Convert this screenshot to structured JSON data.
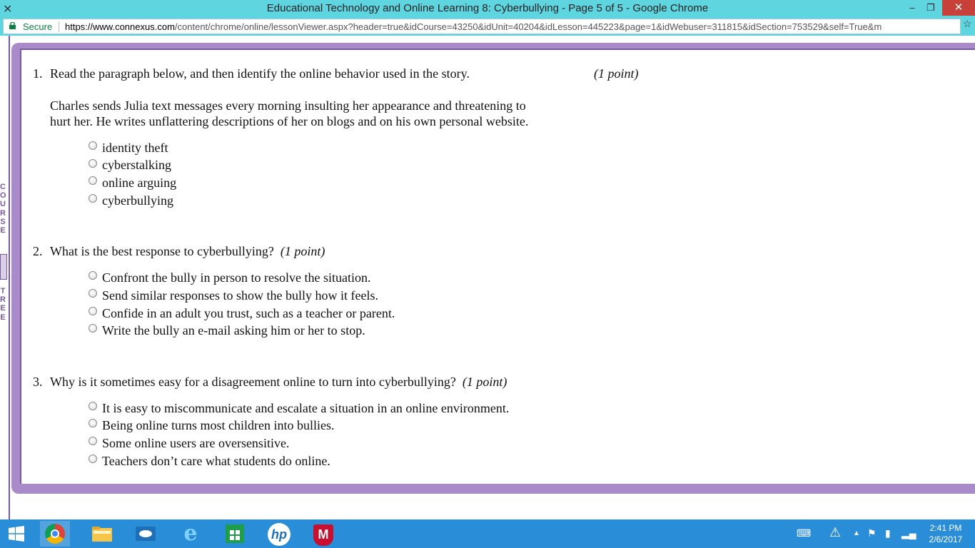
{
  "window": {
    "title": "Educational Technology and Online Learning 8: Cyberbullying - Page 5 of 5 - Google Chrome",
    "minimize": "–",
    "maximize": "❐",
    "close": "✕"
  },
  "address": {
    "secure_label": "Secure",
    "url_domain": "https://www.connexus.com",
    "url_rest": "/content/chrome/online/lessonViewer.aspx?header=true&idCourse=43250&idUnit=40204&idLesson=445223&page=1&idWebuser=311815&idSection=753529&self=True&m"
  },
  "course_tree": {
    "letters": "C O U R S E",
    "letters2": "T R E E"
  },
  "questions": [
    {
      "number": "1.",
      "prompt": "Read the paragraph below, and then identify the online behavior used in the story.",
      "points": "(1 point)",
      "passage_line1": "Charles sends Julia text messages every morning insulting her appearance and threatening to",
      "passage_line2": "hurt her. He writes unflattering descriptions of her on blogs and on his own personal website.",
      "options": [
        "identity theft",
        "cyberstalking",
        "online arguing",
        "cyberbullying"
      ]
    },
    {
      "number": "2.",
      "prompt": "What is the best response to cyberbullying?",
      "points": "(1 point)",
      "options": [
        "Confront the bully in person to resolve the situation.",
        "Send similar responses to show the bully how it feels.",
        "Confide in an adult you trust, such as a teacher or parent.",
        "Write the bully an e-mail asking him or her to stop."
      ]
    },
    {
      "number": "3.",
      "prompt": "Why is it sometimes easy for a disagreement online to turn into cyberbullying?",
      "points": "(1 point)",
      "options": [
        "It is easy to miscommunicate and escalate a situation in an online environment.",
        "Being online turns most children into bullies.",
        "Some online users are oversensitive.",
        "Teachers don’t care what students do online."
      ]
    }
  ],
  "taskbar": {
    "clock_time": "2:41 PM",
    "clock_date": "2/6/2017",
    "hp_label": "hp",
    "mcafee_label": "M"
  },
  "colors": {
    "titlebar": "#5fd5e0",
    "frame": "#a98bc9",
    "accent": "#7b5a9c",
    "taskbar": "#2a8dd8"
  }
}
